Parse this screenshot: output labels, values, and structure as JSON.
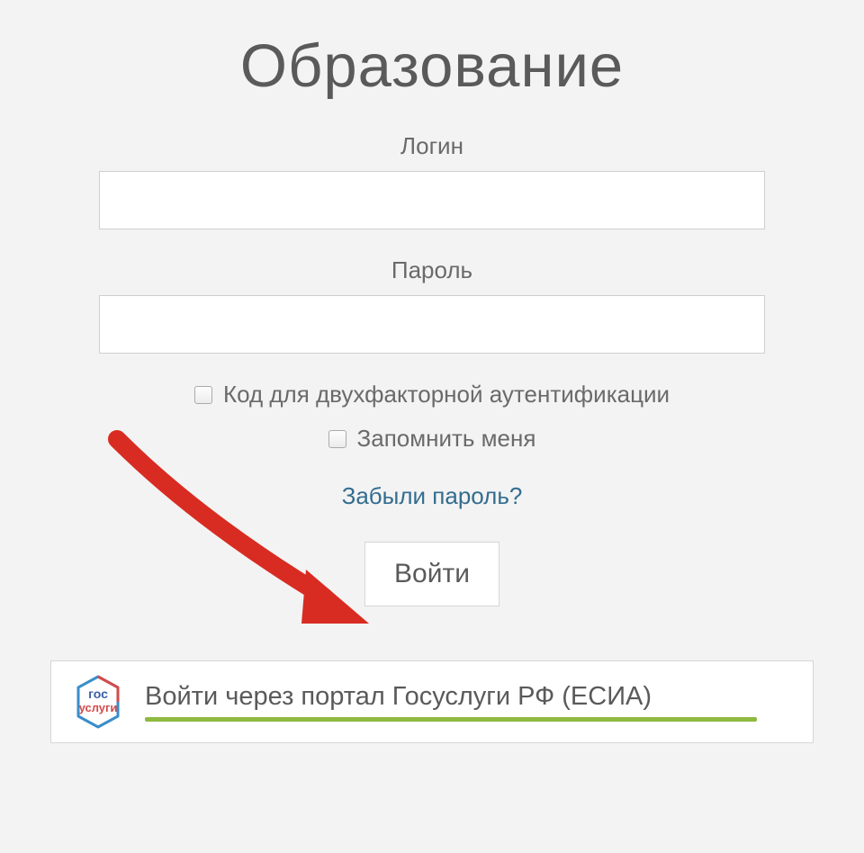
{
  "page": {
    "title": "Образование"
  },
  "fields": {
    "login_label": "Логин",
    "login_value": "",
    "password_label": "Пароль",
    "password_value": ""
  },
  "checkboxes": {
    "two_factor_label": "Код для двухфакторной аутентификации",
    "remember_label": "Запомнить меня"
  },
  "links": {
    "forgot_password": "Забыли пароль?"
  },
  "buttons": {
    "login": "Войти",
    "gosuslugi": "Войти через портал Госуслуги РФ (ЕСИА)"
  },
  "logo": {
    "line1": "гос",
    "line2": "услуги"
  },
  "colors": {
    "accent_blue": "#336d8f",
    "underline_green": "#8fb93f",
    "arrow_red": "#d82c22"
  }
}
